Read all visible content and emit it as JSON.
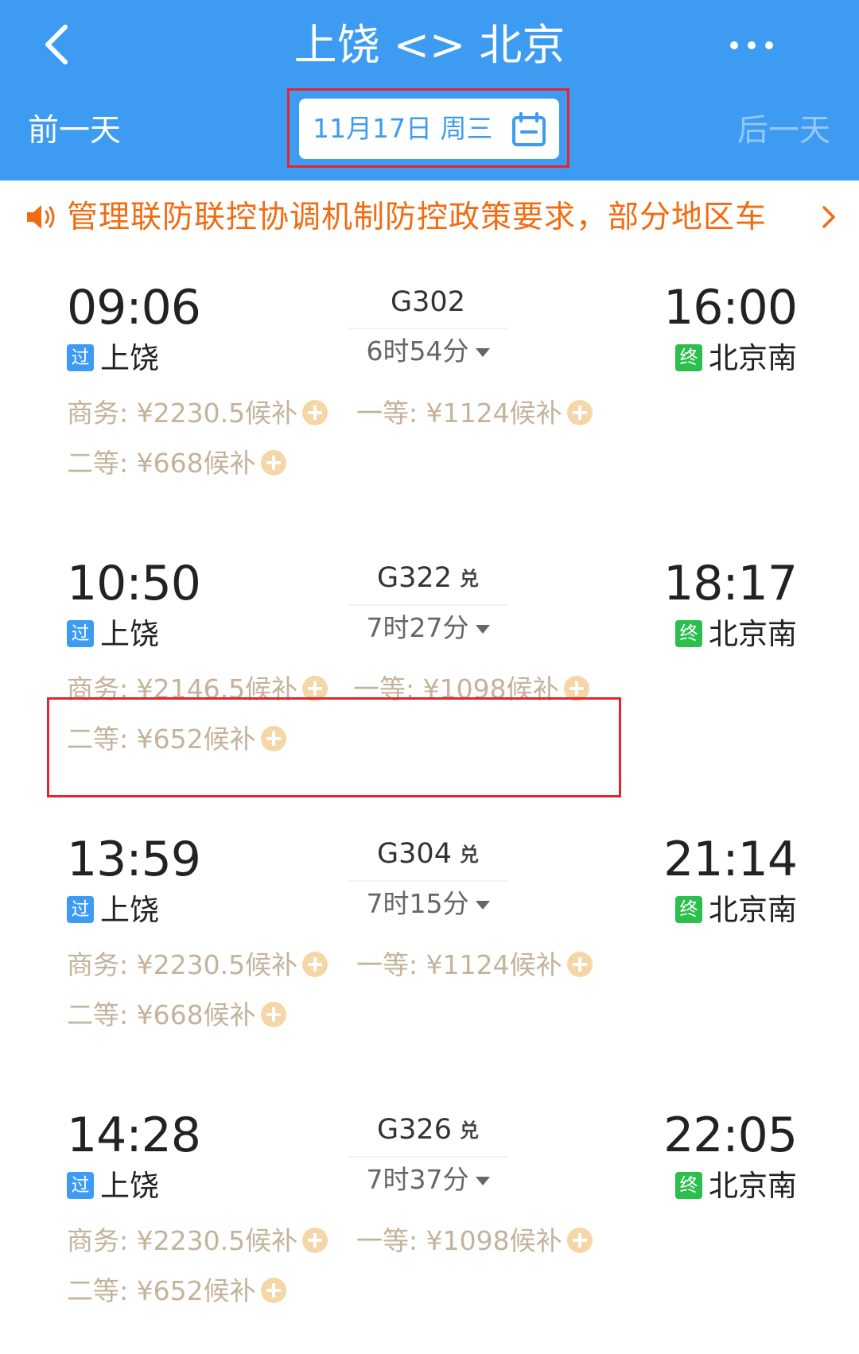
{
  "header": {
    "title": "上饶 <> 北京",
    "prev_day": "前一天",
    "next_day": "后一天",
    "date": "11月17日 周三",
    "icons": {
      "back": "chevron-left-icon",
      "more": "more-dots-icon",
      "calendar": "calendar-icon"
    }
  },
  "notice": {
    "text": "管理联防联控协调机制防控政策要求，部分地区车",
    "text_color": "#f26b10",
    "icons": {
      "speaker": "speaker-icon",
      "arrow": "chevron-right-icon"
    }
  },
  "colors": {
    "header_bg": "#3d9cf2",
    "price_text": "#c4b39a",
    "pass_tag": "#3d9cf2",
    "end_tag": "#2dbf4e",
    "annotation": "#e3262c"
  },
  "trains": [
    {
      "dep_time": "09:06",
      "dep_station": "上饶",
      "dep_tag": "过",
      "train_no": "G302",
      "dui": "",
      "duration": "6时54分",
      "arr_time": "16:00",
      "arr_station": "北京南",
      "arr_tag": "终",
      "business": "商务: ¥2230.5候补",
      "first": "一等: ¥1124候补",
      "second": "二等: ¥668候补"
    },
    {
      "dep_time": "10:50",
      "dep_station": "上饶",
      "dep_tag": "过",
      "train_no": "G322",
      "dui": "兑",
      "duration": "7时27分",
      "arr_time": "18:17",
      "arr_station": "北京南",
      "arr_tag": "终",
      "business": "商务: ¥2146.5候补",
      "first": "一等: ¥1098候补",
      "second": "二等: ¥652候补"
    },
    {
      "dep_time": "13:59",
      "dep_station": "上饶",
      "dep_tag": "过",
      "train_no": "G304",
      "dui": "兑",
      "duration": "7时15分",
      "arr_time": "21:14",
      "arr_station": "北京南",
      "arr_tag": "终",
      "business": "商务: ¥2230.5候补",
      "first": "一等: ¥1124候补",
      "second": "二等: ¥668候补"
    },
    {
      "dep_time": "14:28",
      "dep_station": "上饶",
      "dep_tag": "过",
      "train_no": "G326",
      "dui": "兑",
      "duration": "7时37分",
      "arr_time": "22:05",
      "arr_station": "北京南",
      "arr_tag": "终",
      "business": "商务: ¥2230.5候补",
      "first": "一等: ¥1098候补",
      "second": "二等: ¥652候补"
    }
  ]
}
